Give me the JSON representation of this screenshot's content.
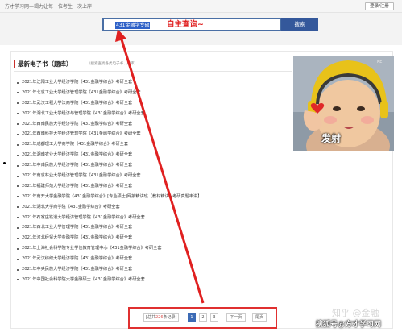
{
  "topbar": {
    "slogan": "方才学习网—竭力让每一位考生一次上岸",
    "login_label": "登录/注册"
  },
  "search": {
    "value": "431金融学专硕",
    "annotation": "自主查询~",
    "button_label": "搜索"
  },
  "section": {
    "title": "最新电子书（题库）",
    "note": "（搜索查找各类电子书、题库）"
  },
  "books": [
    "2021年沈阳工业大学经济学院《431金融学综合》考研全套",
    "2021年北京工业大学经济管理学院《431金融学综合》考研全套",
    "2021年武汉工程大学法商学院《431金融学综合》考研全套",
    "2021年湖北工业大学经济与管理学院《431金融学综合》考研全套",
    "2021年西南民族大学经济学院《431金融学综合》考研全套",
    "2021年西南科技大学经济管理学院《431金融学综合》考研全套",
    "2021年成都理工大学商学院《431金融学综合》考研全套",
    "2021年湖南农业大学经济学院《431金融学综合》考研全套",
    "2021年中南民族大学经济学院《431金融学综合》考研全套",
    "2021年南京林业大学经济管理学院《431金融学综合》考研全套",
    "2021年福建师范大学经济学院《431金融学综合》考研全套",
    "2021年南开大学金融学院《431金融学综合》[专业硕士]网授精讲班【教材精讲+考研真题串讲】",
    "2021年湖北大学商学院《431金融学综合》考研全套",
    "2021年石家庄铁道大学经济管理学院《431金融学综合》考研全套",
    "2021年西北工业大学管理学院《431金融学综合》考研全套",
    "2021年河北经贸大学金融学院《431金融学综合》考研全套",
    "2021年上海社会科学院专业学位教育管理中心《431金融学综合》考研全套",
    "2021年武汉纺织大学经济学院《431金融学综合》考研全套",
    "2021年中央民族大学经济学院《431金融学综合》考研全套",
    "2021年中国社会科学院大学金融硕士《431金融学综合》考研全套"
  ],
  "pagination": {
    "info_prefix": "[总共",
    "info_total": "226",
    "info_suffix": "条记录]",
    "pages": [
      "1",
      "2",
      "3"
    ],
    "next_label": "下一页",
    "last_label": "尾页"
  },
  "meme": {
    "caption": "发射",
    "corner_text": "KE"
  },
  "watermarks": {
    "zhihu": "知乎 @金融",
    "sohu": "搜狐号@方才学习网"
  },
  "colors": {
    "accent_red": "#e02020",
    "search_border": "#4a6fa5",
    "search_button": "#34589b",
    "page_active": "#3c6bb5"
  }
}
